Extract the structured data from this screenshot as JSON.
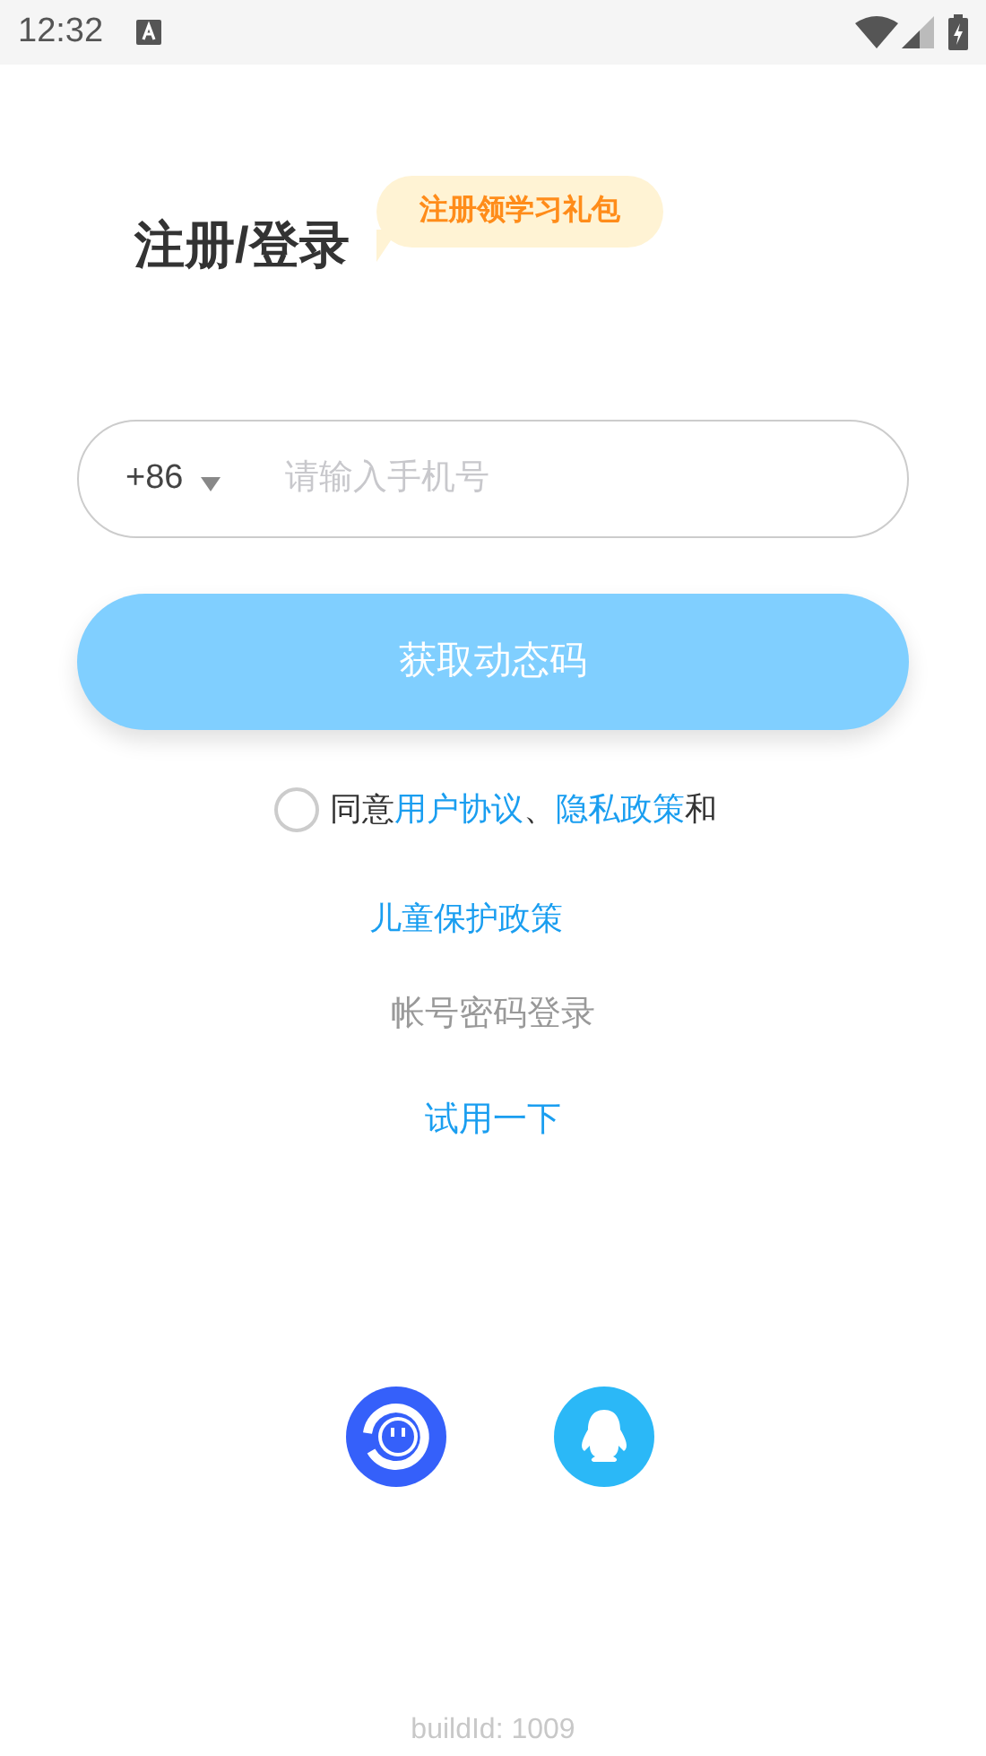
{
  "status_bar": {
    "time": "12:32"
  },
  "title": "注册/登录",
  "promo_badge": "注册领学习礼包",
  "phone_field": {
    "country_code": "+86",
    "placeholder": "请输入手机号"
  },
  "get_code_button": {
    "label": "获取动态码",
    "disabled": true
  },
  "agreement": {
    "checked": false,
    "parts": [
      {
        "kind": "plain",
        "text": "同意"
      },
      {
        "kind": "link",
        "text": "用户协议"
      },
      {
        "kind": "plain",
        "text": "、"
      },
      {
        "kind": "link",
        "text": "隐私政策"
      },
      {
        "kind": "plain",
        "text": "和"
      }
    ]
  },
  "children_policy_link": "儿童保护政策",
  "password_login_link": "帐号密码登录",
  "try_link": "试用一下",
  "social_logins": [
    {
      "kind": "app"
    },
    {
      "kind": "qq"
    }
  ],
  "build_id": "buildId: 1009"
}
